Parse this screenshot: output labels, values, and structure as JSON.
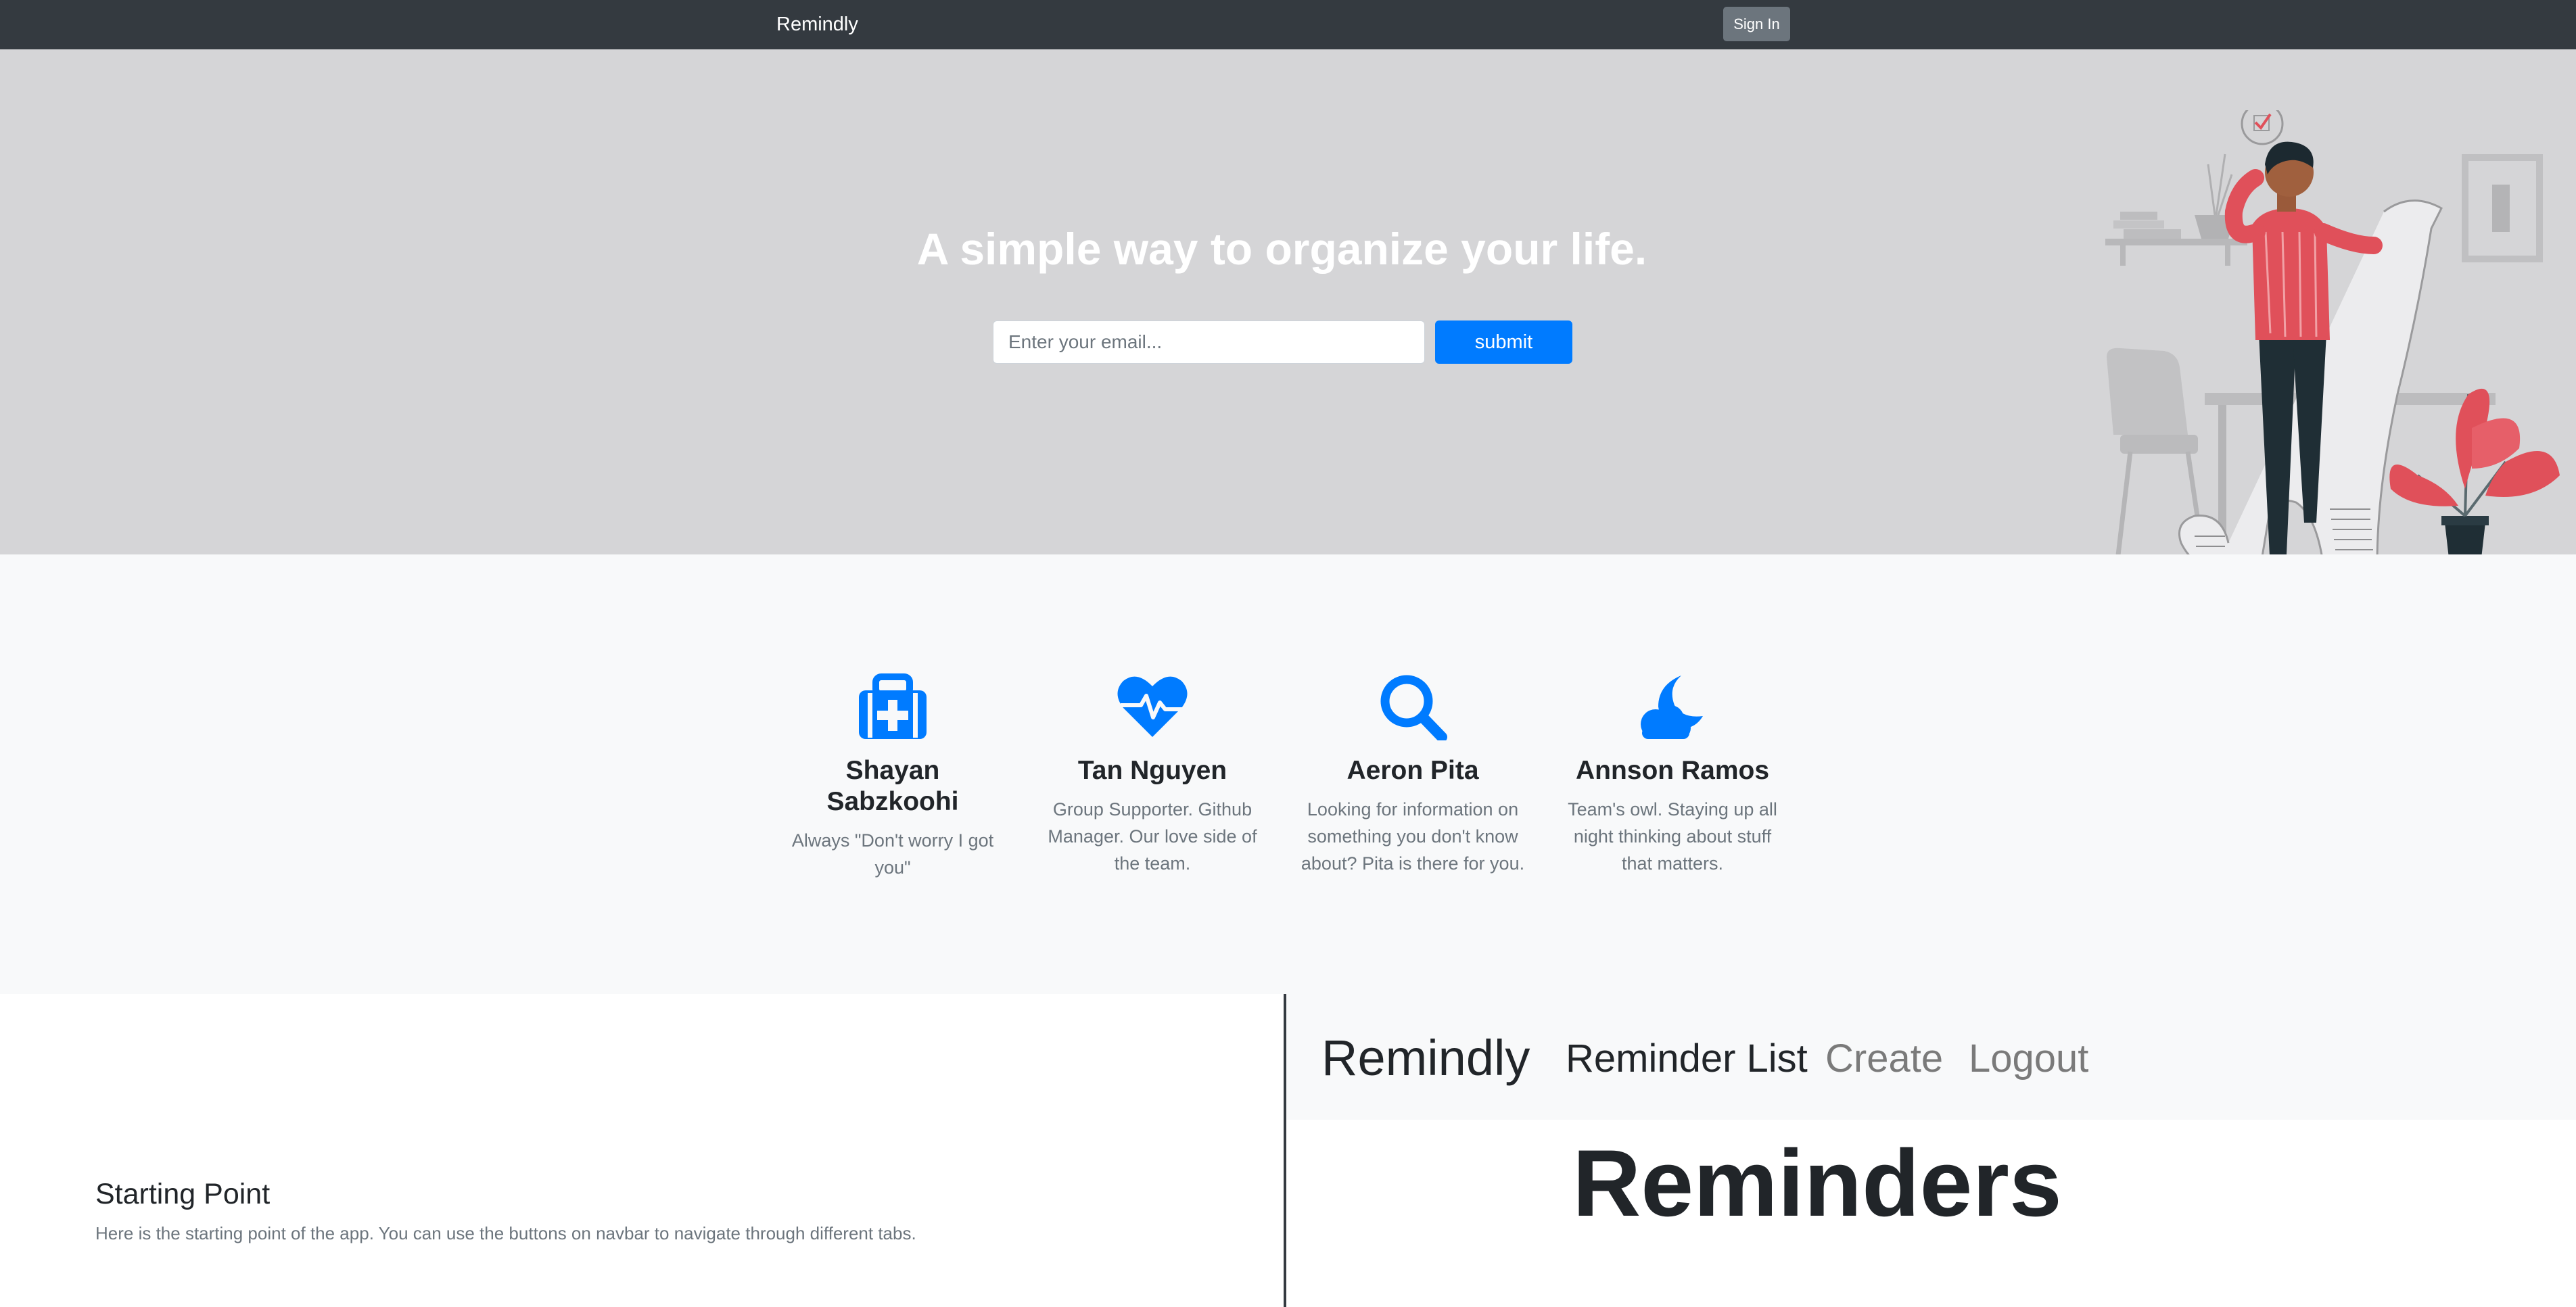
{
  "navbar": {
    "brand": "Remindly",
    "sign_in_label": "Sign In"
  },
  "hero": {
    "title": "A simple way to organize your life.",
    "email_placeholder": "Enter your email...",
    "submit_label": "submit"
  },
  "features": [
    {
      "icon": "medkit-icon",
      "name": "Shayan Sabzkoohi",
      "desc": "Always \"Don't worry I got you\""
    },
    {
      "icon": "heartbeat-icon",
      "name": "Tan Nguyen",
      "desc": "Group Supporter. Github Manager. Our love side of the team."
    },
    {
      "icon": "search-icon",
      "name": "Aeron Pita",
      "desc": "Looking for information on something you don't know about? Pita is there for you."
    },
    {
      "icon": "cloud-moon-icon",
      "name": "Annson Ramos",
      "desc": "Team's owl. Staying up all night thinking about stuff that matters."
    }
  ],
  "showcase": {
    "title": "Starting Point",
    "desc": "Here is the starting point of the app. You can use the buttons on navbar to navigate through different tabs.",
    "preview": {
      "brand": "Remindly",
      "links": [
        "Reminder List",
        "Create",
        "Logout"
      ],
      "heading": "Reminders"
    }
  },
  "colors": {
    "navbar_bg": "#343a40",
    "hero_bg": "#d5d5d7",
    "accent": "#007bff",
    "illustration_red": "#e0505a",
    "secondary_button": "#6c757d"
  }
}
